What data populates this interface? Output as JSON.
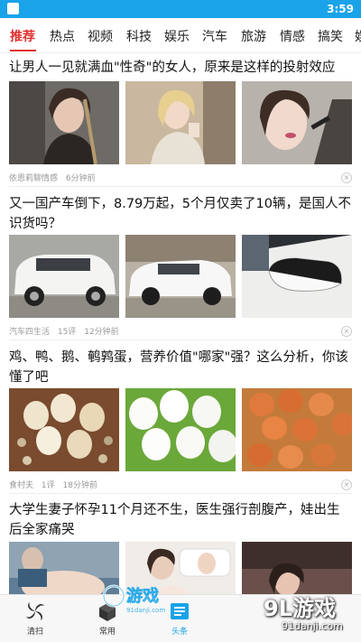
{
  "status": {
    "time": "3:59"
  },
  "tabs": [
    "推荐",
    "热点",
    "视频",
    "科技",
    "娱乐",
    "汽车",
    "旅游",
    "情感",
    "搞笑",
    "娱"
  ],
  "articles": [
    {
      "title": "让男人一见就满血\"性奇\"的女人，原来是这样的投射效应",
      "source": "依恩莉聊情感",
      "comments": "",
      "time": "6分钟前"
    },
    {
      "title": "又一国产车倒下，8.79万起，5个月仅卖了10辆，是国人不识货吗？",
      "source": "汽车四生活",
      "comments": "15评",
      "time": "12分钟前"
    },
    {
      "title": "鸡、鸭、鹅、鹌鹑蛋，营养价值\"哪家\"强？这么分析，你该懂了吧",
      "source": "食村夫",
      "comments": "1评",
      "time": "18分钟前"
    },
    {
      "title": "大学生妻子怀孕11个月还不生，医生强行剖腹产，娃出生后全家痛哭",
      "source": "",
      "comments": "",
      "time": ""
    }
  ],
  "bottom_nav": [
    {
      "label": "清扫",
      "icon": "clean-icon",
      "active": false
    },
    {
      "label": "常用",
      "icon": "toolbox-icon",
      "active": false
    },
    {
      "label": "头条",
      "icon": "headlines-icon",
      "active": true
    }
  ],
  "watermark": {
    "logo_text": "9L游戏",
    "url": "91danji.com"
  },
  "colors": {
    "status_bar": "#1aa3e8",
    "active_tab": "#e02f2f",
    "active_nav": "#1aa3e8"
  }
}
